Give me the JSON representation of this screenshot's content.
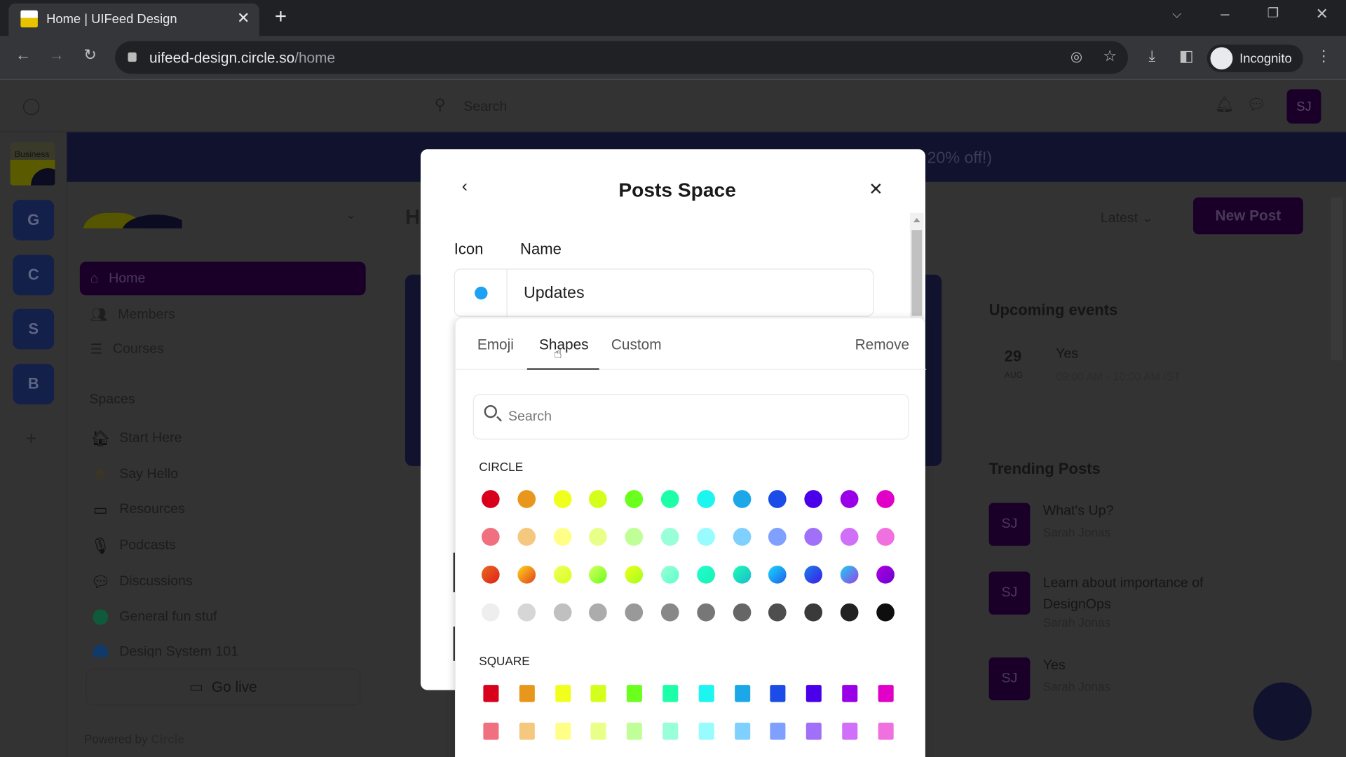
{
  "browser": {
    "tab_title": "Home | UIFeed Design",
    "url_host": "uifeed-design.circle.so",
    "url_path": "/home",
    "profile_label": "Incognito"
  },
  "topbar": {
    "search_placeholder": "Search",
    "avatar_initials": "SJ"
  },
  "banner": {
    "text_visible": "20% off!)"
  },
  "rail": {
    "logo_text": "Business",
    "communities": [
      "G",
      "C",
      "S",
      "B"
    ],
    "add_label": "+"
  },
  "sidebar": {
    "nav": [
      {
        "label": "Home",
        "icon": "home-icon",
        "active": true
      },
      {
        "label": "Members",
        "icon": "members-icon"
      },
      {
        "label": "Courses",
        "icon": "courses-icon"
      }
    ],
    "spaces_heading": "Spaces",
    "spaces": [
      {
        "label": "Start Here",
        "icon": "house-emoji"
      },
      {
        "label": "Say Hello",
        "icon": "waving-hand-emoji"
      },
      {
        "label": "Resources",
        "icon": "book-emoji"
      },
      {
        "label": "Podcasts",
        "icon": "microphone-emoji"
      },
      {
        "label": "Discussions",
        "icon": "speech-bubble-emoji"
      },
      {
        "label": "General fun stuf",
        "icon": "green-circle"
      },
      {
        "label": "Design System 101",
        "icon": "blue-circle"
      }
    ],
    "go_live": "Go live",
    "powered_by": "Powered by",
    "powered_brand": "Circle"
  },
  "main": {
    "heading_visible": "H",
    "sort_label": "Latest",
    "new_post": "New Post",
    "upcoming_title": "Upcoming events",
    "event": {
      "day": "29",
      "month": "AUG",
      "title": "Yes",
      "time": "09:00 AM - 10:00 AM IST"
    },
    "trending_title": "Trending Posts",
    "trending": [
      {
        "initials": "SJ",
        "title": "What's Up?",
        "author": "Sarah Jonas"
      },
      {
        "initials": "SJ",
        "title": "Learn about importance of DesignOps",
        "author": "Sarah Jonas"
      },
      {
        "initials": "SJ",
        "title": "Yes",
        "author": "Sarah Jonas"
      }
    ]
  },
  "modal": {
    "title": "Posts Space",
    "icon_label": "Icon",
    "name_label": "Name",
    "name_value": "Updates",
    "selected_icon_color": "#1da1f2"
  },
  "picker": {
    "tabs": [
      "Emoji",
      "Shapes",
      "Custom"
    ],
    "active_tab": "Shapes",
    "remove": "Remove",
    "search_placeholder": "Search",
    "circle_label": "CIRCLE",
    "square_label": "SQUARE",
    "circle_rows": [
      [
        "#d9001b",
        "#e8961c",
        "#f0ff1c",
        "#d4ff1c",
        "#6aff1c",
        "#1cffa8",
        "#1cf5f0",
        "#1ca8e8",
        "#1c4ce8",
        "#4a00e8",
        "#9a00e8",
        "#e000c8"
      ],
      [
        "#f07080",
        "#f5c880",
        "#ffff88",
        "#e8ff88",
        "#c0ff98",
        "#98ffd8",
        "#98fcff",
        "#80d0ff",
        "#80a0ff",
        "#a070f8",
        "#d070f8",
        "#f070e0"
      ],
      [
        "linear-gradient(135deg,#e86a1c,#e0201c)",
        "linear-gradient(135deg,#ffd81c,#e0401c)",
        "linear-gradient(135deg,#f0ff60,#d8ff1c)",
        "linear-gradient(135deg,#d8ff60,#6aff1c)",
        "linear-gradient(135deg,#f0ff1c,#a0ff1c)",
        "linear-gradient(135deg,#98ffd8,#60ffc8)",
        "linear-gradient(135deg,#1cffd0,#1cf0b0)",
        "linear-gradient(135deg,#1cffb0,#1cb8d0)",
        "linear-gradient(135deg,#1cd8ff,#1c60e8)",
        "linear-gradient(135deg,#1c80e8,#3a1ce8)",
        "linear-gradient(135deg,#1cd0f0,#9a40e8)",
        "linear-gradient(135deg,#b000e0,#6a00d0)"
      ],
      [
        "#eeeeee",
        "#d6d6d6",
        "#c0c0c0",
        "#acacac",
        "#999999",
        "#888888",
        "#777777",
        "#666666",
        "#4e4e4e",
        "#3a3a3a",
        "#222222",
        "#0e0e0e"
      ]
    ],
    "square_rows": [
      [
        "#d9001b",
        "#e8961c",
        "#f0ff1c",
        "#d4ff1c",
        "#6aff1c",
        "#1cffa8",
        "#1cf5f0",
        "#1ca8e8",
        "#1c4ce8",
        "#4a00e8",
        "#9a00e8",
        "#e000c8"
      ],
      [
        "#f07080",
        "#f5c880",
        "#ffff88",
        "#e8ff88",
        "#c0ff98",
        "#98ffd8",
        "#98fcff",
        "#80d0ff",
        "#80a0ff",
        "#a070f8",
        "#d070f8",
        "#f070e0"
      ]
    ]
  }
}
